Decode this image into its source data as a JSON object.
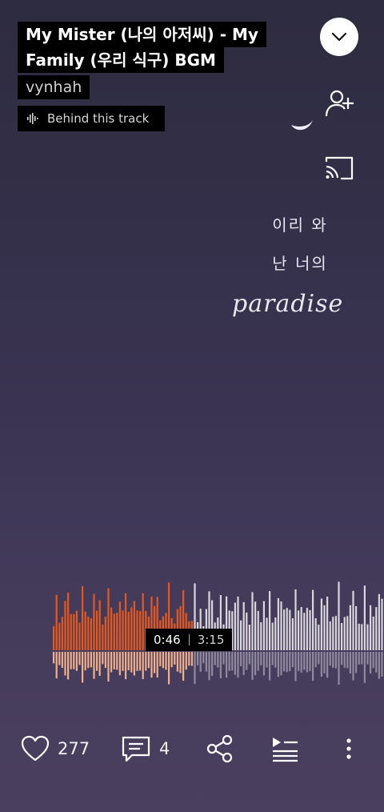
{
  "track": {
    "title_line1": "My Mister (나의 아저씨) - My",
    "title_line2": "Family (우리 식구) BGM",
    "artist": "vynhah",
    "behind_label": "Behind this track"
  },
  "artwork": {
    "line1": "이리 와",
    "line2": "난 너의",
    "script_word": "paradise"
  },
  "player": {
    "current_time": "0:46",
    "total_time": "3:15",
    "progress": 0.236,
    "played_color": "#e8571c",
    "played_reflection_color": "#f1b08c",
    "unplayed_color": "#d8d6da",
    "unplayed_reflection_color": "#8f8aa0"
  },
  "actions": {
    "likes": "277",
    "comments": "4"
  },
  "icons": {
    "collapse": "chevron-down-icon",
    "follow": "add-user-icon",
    "cast": "cast-icon",
    "waveform": "waveform-icon",
    "like": "heart-icon",
    "comment": "comment-icon",
    "share": "share-icon",
    "queue": "queue-icon",
    "more": "more-vertical-icon"
  }
}
